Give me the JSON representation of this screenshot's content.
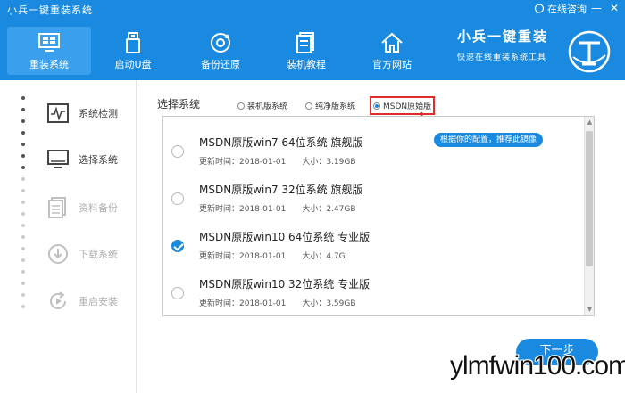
{
  "window": {
    "title": "小兵一键重装系统",
    "consult_label": "在线咨询",
    "minimize_glyph": "—",
    "close_glyph": "✕"
  },
  "nav": {
    "items": [
      {
        "label": "重装系统",
        "icon": "monitor-icon",
        "active": true
      },
      {
        "label": "启动U盘",
        "icon": "usb-icon",
        "active": false
      },
      {
        "label": "备份还原",
        "icon": "backup-restore-icon",
        "active": false
      },
      {
        "label": "装机教程",
        "icon": "tutorial-icon",
        "active": false
      },
      {
        "label": "官方网站",
        "icon": "home-icon",
        "active": false
      }
    ],
    "brand_name": "小兵一键重装",
    "brand_slogan": "快速在线重装系统工具"
  },
  "steps": [
    {
      "label": "系统检测",
      "icon": "pulse-icon",
      "state": "done"
    },
    {
      "label": "选择系统",
      "icon": "monitor-icon",
      "state": "current"
    },
    {
      "label": "资料备份",
      "icon": "document-icon",
      "state": "pending"
    },
    {
      "label": "下载系统",
      "icon": "download-icon",
      "state": "pending"
    },
    {
      "label": "重启安装",
      "icon": "restart-icon",
      "state": "pending"
    }
  ],
  "selector": {
    "label": "选择系统",
    "options": [
      {
        "label": "装机版系统",
        "selected": false
      },
      {
        "label": "纯净版系统",
        "selected": false
      },
      {
        "label": "MSDN原始版",
        "selected": true
      }
    ]
  },
  "systems": [
    {
      "name": "MSDN原版win7 64位系统 旗舰版",
      "update": "更新时间：2018-01-01",
      "size": "大小：3.19GB",
      "checked": false
    },
    {
      "name": "MSDN原版win7 32位系统 旗舰版",
      "update": "更新时间：2018-01-01",
      "size": "大小：2.47GB",
      "checked": false
    },
    {
      "name": "MSDN原版win10 64位系统 专业版",
      "update": "更新时间：2018-01-01",
      "size": "大小：4.7G",
      "checked": true
    },
    {
      "name": "MSDN原版win10 32位系统 专业版",
      "update": "更新时间：2018-01-01",
      "size": "大小：3.59GB",
      "checked": false
    }
  ],
  "tip": "根据你的配置，推荐此镜像",
  "next_button": "下一步",
  "watermark": "ylmfwin100.com",
  "colors": {
    "accent": "#1a8ae0",
    "highlight": "#e02b2b",
    "step_done": "#444444",
    "step_pending": "#b0b0b0"
  }
}
